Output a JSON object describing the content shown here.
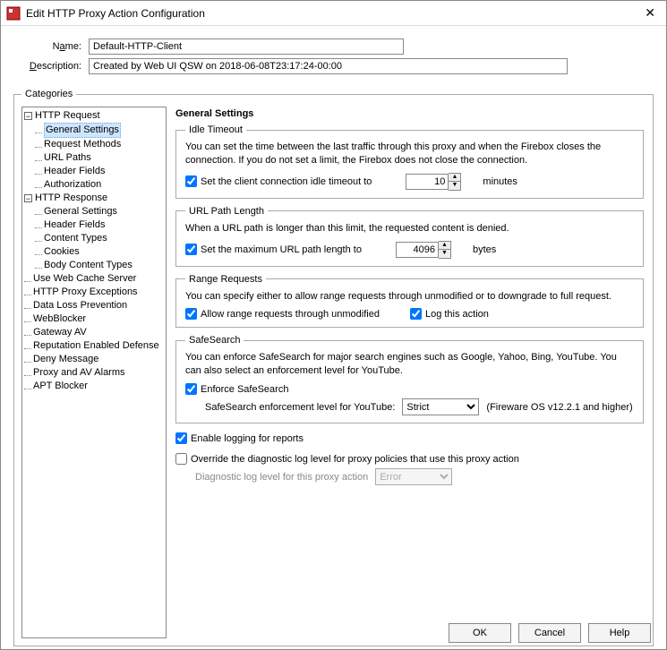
{
  "window": {
    "title": "Edit HTTP Proxy Action Configuration"
  },
  "form": {
    "name_label_pre": "N",
    "name_label_ul": "a",
    "name_label_post": "me:",
    "name_value": "Default-HTTP-Client",
    "desc_label_ul": "D",
    "desc_label_post": "escription:",
    "desc_value": "Created by Web UI QSW on 2018-06-08T23:17:24-00:00"
  },
  "categories_legend": "Categories",
  "tree": {
    "http_request": "HTTP Request",
    "req_general": "General Settings",
    "req_methods": "Request Methods",
    "req_urlpaths": "URL Paths",
    "req_headers": "Header Fields",
    "req_auth": "Authorization",
    "http_response": "HTTP Response",
    "resp_general": "General Settings",
    "resp_headers": "Header Fields",
    "resp_content": "Content Types",
    "resp_cookies": "Cookies",
    "resp_body": "Body Content Types",
    "web_cache": "Use Web Cache Server",
    "proxy_exc": "HTTP Proxy Exceptions",
    "dlp": "Data Loss Prevention",
    "webblocker": "WebBlocker",
    "gateway_av": "Gateway AV",
    "rep_def": "Reputation Enabled Defense",
    "deny_msg": "Deny Message",
    "alarms": "Proxy and AV Alarms",
    "apt": "APT Blocker"
  },
  "settings": {
    "heading": "General Settings",
    "idle": {
      "legend": "Idle Timeout",
      "desc": "You can set the time between the last traffic through this proxy and when the Firebox closes the connection. If you do not set a limit, the Firebox does not close the connection.",
      "chk_label": "Set the client connection idle timeout to",
      "value": "10",
      "unit": "minutes"
    },
    "url": {
      "legend": "URL Path Length",
      "desc": "When a URL path is longer than this limit, the requested content is denied.",
      "chk_label": "Set the maximum URL path length to",
      "value": "4096",
      "unit": "bytes"
    },
    "range": {
      "legend": "Range Requests",
      "desc": "You can specify either to allow range requests through unmodified or to downgrade to full request.",
      "chk_allow": "Allow range requests through unmodified",
      "chk_log": "Log this action"
    },
    "safesearch": {
      "legend": "SafeSearch",
      "desc": "You can enforce SafeSearch for major search engines such as Google, Yahoo, Bing, YouTube. You can also select an enforcement level for YouTube.",
      "chk_enforce": "Enforce SafeSearch",
      "level_label": "SafeSearch enforcement level for YouTube:",
      "level_value": "Strict",
      "note": "(Fireware OS v12.2.1 and higher)"
    },
    "logging_chk": "Enable logging for reports",
    "override_chk": "Override the diagnostic log level for proxy policies that use this proxy action",
    "diag_label": "Diagnostic log level for this proxy action",
    "diag_value": "Error"
  },
  "buttons": {
    "ok": "OK",
    "cancel": "Cancel",
    "help": "Help"
  }
}
